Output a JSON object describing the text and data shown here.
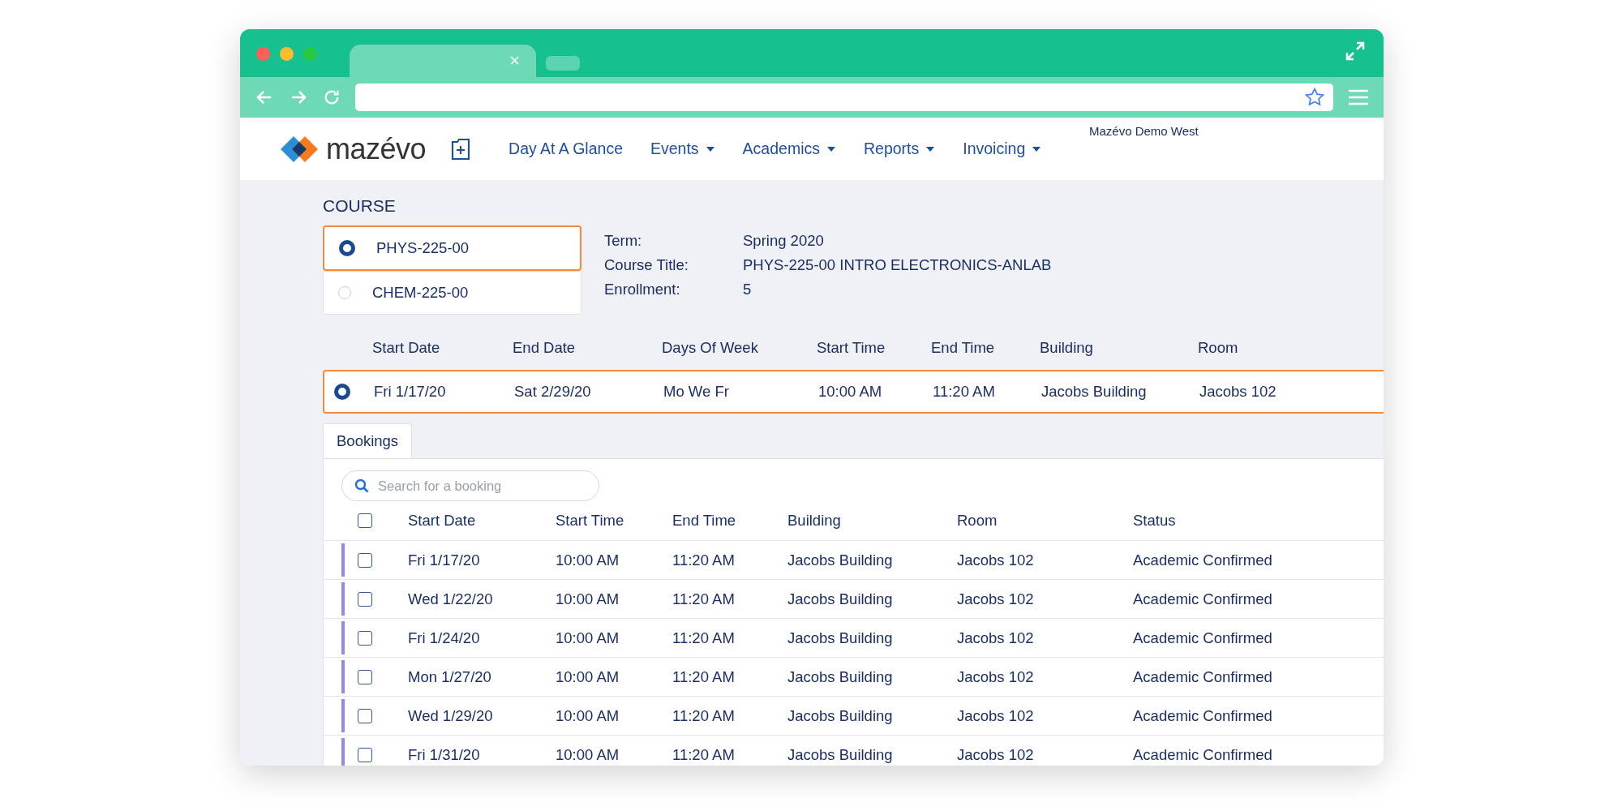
{
  "browser": {
    "tabs": [
      {
        "close": "×",
        "selected": true
      },
      {
        "selected": false
      }
    ]
  },
  "header": {
    "logo": "mazévo",
    "nav": [
      {
        "label": "Day At A Glance",
        "has_menu": false
      },
      {
        "label": "Events",
        "has_menu": true
      },
      {
        "label": "Academics",
        "has_menu": true
      },
      {
        "label": "Reports",
        "has_menu": true
      },
      {
        "label": "Invoicing",
        "has_menu": true
      }
    ],
    "organization": "Mazévo Demo West"
  },
  "course": {
    "heading": "COURSE",
    "options": [
      {
        "label": "PHYS-225-00",
        "selected": true
      },
      {
        "label": "CHEM-225-00",
        "selected": false
      }
    ],
    "details": [
      {
        "label": "Term:",
        "value": "Spring 2020"
      },
      {
        "label": "Course Title:",
        "value": "PHYS-225-00 INTRO ELECTRONICS-ANLAB"
      },
      {
        "label": "Enrollment:",
        "value": "5"
      }
    ]
  },
  "sections": {
    "columns": [
      "Start Date",
      "End Date",
      "Days Of Week",
      "Start Time",
      "End Time",
      "Building",
      "Room"
    ],
    "rows": [
      {
        "selected": true,
        "cells": [
          "Fri 1/17/20",
          "Sat 2/29/20",
          "Mo We Fr",
          "10:00 AM",
          "11:20 AM",
          "Jacobs Building",
          "Jacobs 102"
        ]
      }
    ]
  },
  "tabs": [
    {
      "label": "Bookings",
      "selected": true
    }
  ],
  "bookings": {
    "search_placeholder": "Search for a booking",
    "select_all_checked": false,
    "columns": [
      "Start Date",
      "Start Time",
      "End Time",
      "Building",
      "Room",
      "Status"
    ],
    "rows": [
      {
        "checked": false,
        "cells": [
          "Fri 1/17/20",
          "10:00 AM",
          "11:20 AM",
          "Jacobs Building",
          "Jacobs 102",
          "Academic Confirmed"
        ]
      },
      {
        "checked": false,
        "cells": [
          "Wed 1/22/20",
          "10:00 AM",
          "11:20 AM",
          "Jacobs Building",
          "Jacobs 102",
          "Academic Confirmed"
        ]
      },
      {
        "checked": false,
        "cells": [
          "Fri 1/24/20",
          "10:00 AM",
          "11:20 AM",
          "Jacobs Building",
          "Jacobs 102",
          "Academic Confirmed"
        ]
      },
      {
        "checked": false,
        "cells": [
          "Mon 1/27/20",
          "10:00 AM",
          "11:20 AM",
          "Jacobs Building",
          "Jacobs 102",
          "Academic Confirmed"
        ]
      },
      {
        "checked": false,
        "cells": [
          "Wed 1/29/20",
          "10:00 AM",
          "11:20 AM",
          "Jacobs Building",
          "Jacobs 102",
          "Academic Confirmed"
        ]
      },
      {
        "checked": false,
        "cells": [
          "Fri 1/31/20",
          "10:00 AM",
          "11:20 AM",
          "Jacobs Building",
          "Jacobs 102",
          "Academic Confirmed"
        ]
      }
    ]
  }
}
